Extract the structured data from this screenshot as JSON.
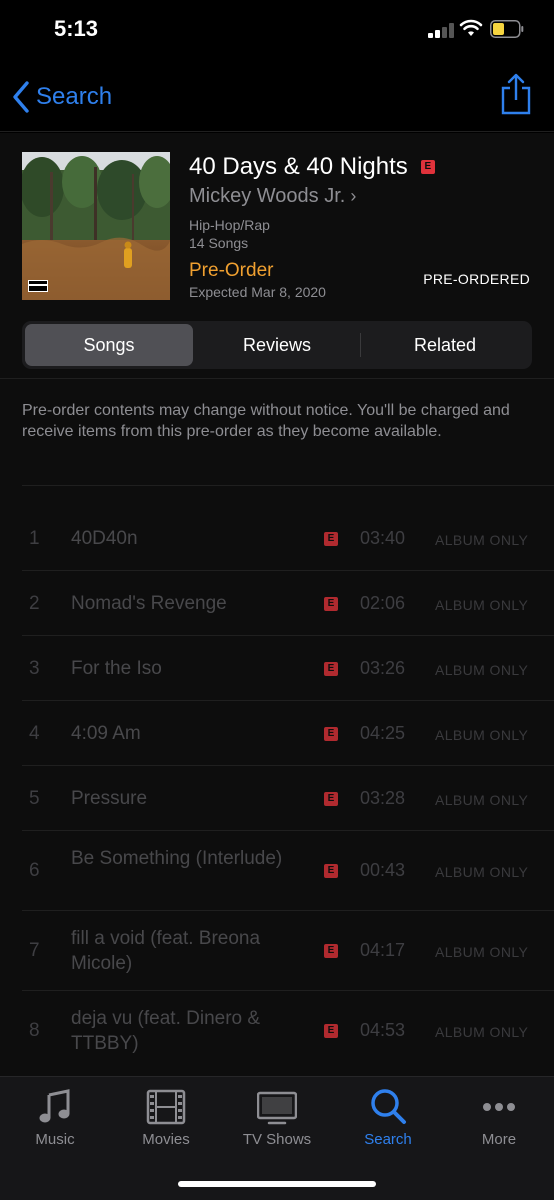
{
  "status_bar": {
    "time": "5:13",
    "battery_color": "#f5d440"
  },
  "nav": {
    "back_label": "Search",
    "share_icon": "share-icon",
    "accent": "#2f80ed"
  },
  "album": {
    "title": "40 Days & 40 Nights",
    "explicit_badge": "E",
    "artist": "Mickey Woods Jr.",
    "artist_chevron": "›",
    "genre": "Hip-Hop/Rap",
    "song_count": "14 Songs",
    "preorder_label": "Pre-Order",
    "expected": "Expected Mar 8, 2020",
    "status": "PRE-ORDERED",
    "accent": "#f0a030"
  },
  "segments": [
    {
      "label": "Songs",
      "active": true
    },
    {
      "label": "Reviews",
      "active": false
    },
    {
      "label": "Related",
      "active": false
    }
  ],
  "notice": "Pre-order contents may change without notice. You'll be charged and receive items from this pre-order as they become available.",
  "tracks": [
    {
      "number": "1",
      "title": "40D40n",
      "explicit": "E",
      "duration": "03:40",
      "price_label": "ALBUM ONLY"
    },
    {
      "number": "2",
      "title": "Nomad's Revenge",
      "explicit": "E",
      "duration": "02:06",
      "price_label": "ALBUM ONLY"
    },
    {
      "number": "3",
      "title": "For the Iso",
      "explicit": "E",
      "duration": "03:26",
      "price_label": "ALBUM ONLY"
    },
    {
      "number": "4",
      "title": "4:09 Am",
      "explicit": "E",
      "duration": "04:25",
      "price_label": "ALBUM ONLY"
    },
    {
      "number": "5",
      "title": "Pressure",
      "explicit": "E",
      "duration": "03:28",
      "price_label": "ALBUM ONLY"
    },
    {
      "number": "6",
      "title": "Be Something (Interlude)",
      "explicit": "E",
      "duration": "00:43",
      "price_label": "ALBUM ONLY"
    },
    {
      "number": "7",
      "title": "fill a void (feat. Breona Micole)",
      "explicit": "E",
      "duration": "04:17",
      "price_label": "ALBUM ONLY"
    },
    {
      "number": "8",
      "title": "deja vu (feat. Dinero & TTBBY)",
      "explicit": "E",
      "duration": "04:53",
      "price_label": "ALBUM ONLY"
    }
  ],
  "tab_bar": [
    {
      "label": "Music",
      "icon": "music-note-icon",
      "active": false
    },
    {
      "label": "Movies",
      "icon": "film-icon",
      "active": false
    },
    {
      "label": "TV Shows",
      "icon": "tv-icon",
      "active": false
    },
    {
      "label": "Search",
      "icon": "search-icon",
      "active": true
    },
    {
      "label": "More",
      "icon": "more-icon",
      "active": false
    }
  ]
}
